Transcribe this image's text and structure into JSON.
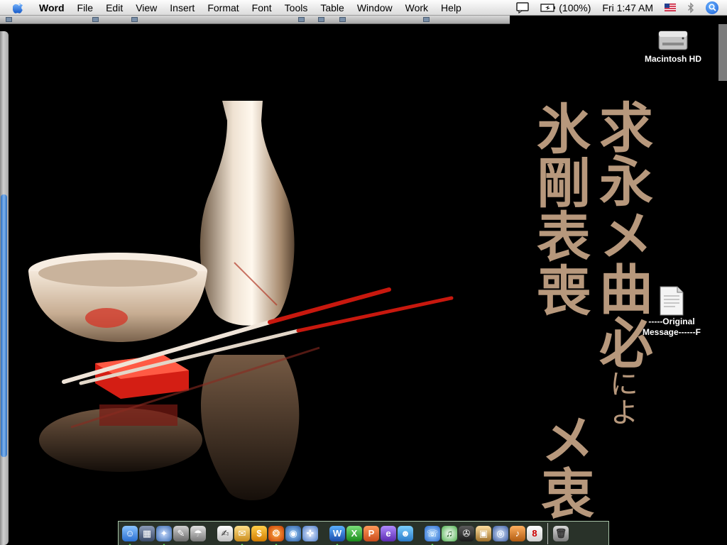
{
  "menubar": {
    "app_name": "Word",
    "menus": [
      "File",
      "Edit",
      "View",
      "Insert",
      "Format",
      "Font",
      "Tools",
      "Table",
      "Window",
      "Work",
      "Help"
    ],
    "battery": "(100%)",
    "clock": "Fri 1:47 AM"
  },
  "desktop": {
    "hd_label": "Macintosh HD",
    "doc_label_line1": "-----Original",
    "doc_label_line2": "Message------F"
  },
  "wallpaper": {
    "calligraphy_left": "氷剛表喪",
    "calligraphy_right": "求永メ曲必",
    "calligraphy_small": "によ",
    "calligraphy_bottom": "メ衷",
    "text_color": "#b7987c"
  },
  "dock": {
    "items_group1": [
      "finder-icon",
      "preview-icon",
      "safari-icon",
      "script-editor-icon",
      "network-icon"
    ],
    "items_group2": [
      "textedit-icon",
      "mail-icon",
      "dollar-app-icon",
      "firefox-icon",
      "browser-icon",
      "compass-icon"
    ],
    "items_group3": [
      "word-icon",
      "excel-icon",
      "powerpoint-icon",
      "entourage-icon",
      "messenger-icon"
    ],
    "items_group4": [
      "ichat-icon",
      "itunes-icon",
      "imovie-icon",
      "iphoto-icon",
      "dvd-player-icon",
      "garageband-icon",
      "calendar-icon"
    ],
    "trash": "trash-icon",
    "calendar_day": "8"
  },
  "colors": {
    "menubar_bg": "#ececec",
    "dock_accent": "#55e055",
    "selection_blue": "#2c6fc0"
  }
}
